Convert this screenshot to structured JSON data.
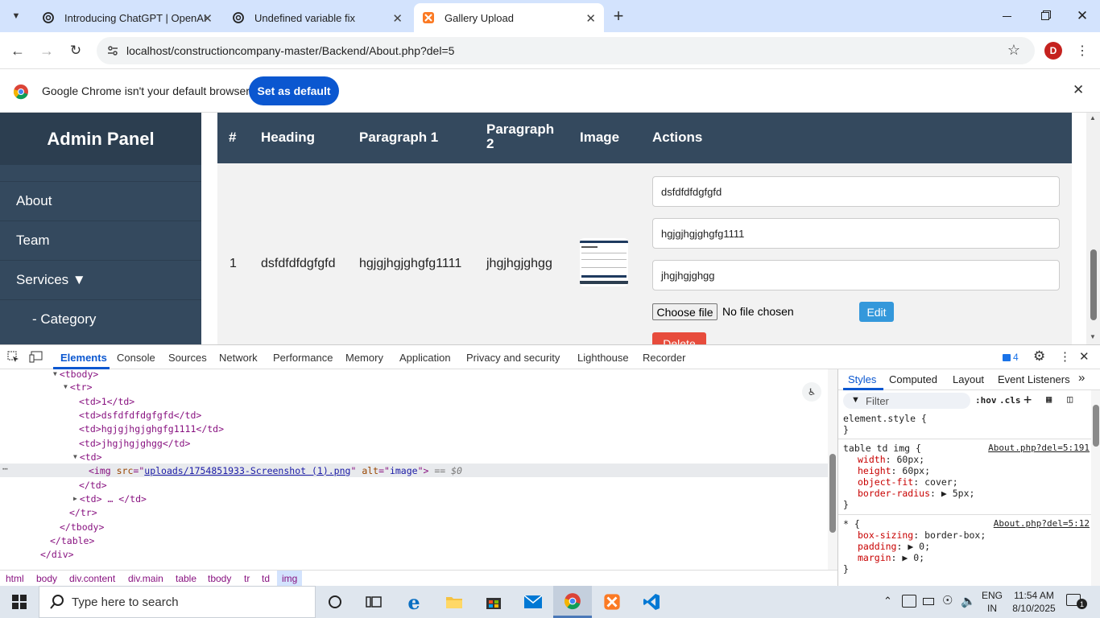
{
  "browser": {
    "tabs": [
      {
        "title": "Introducing ChatGPT | OpenAI",
        "active": false
      },
      {
        "title": "Undefined variable fix",
        "active": false
      },
      {
        "title": "Gallery Upload",
        "active": true
      }
    ],
    "url": "localhost/constructioncompany-master/Backend/About.php?del=5",
    "profile_initial": "D",
    "infobar_text": "Google Chrome isn't your default browser",
    "infobar_button": "Set as default"
  },
  "sidebar": {
    "brand": "Admin Panel",
    "items": [
      {
        "label": "About"
      },
      {
        "label": "Team"
      },
      {
        "label": "Services ▼"
      },
      {
        "label": "- Category"
      }
    ]
  },
  "table": {
    "headers": [
      "#",
      "Heading",
      "Paragraph 1",
      "Paragraph 2",
      "Image",
      "Actions"
    ],
    "row": {
      "id": "1",
      "heading": "dsfdfdfdgfgfd",
      "paragraph1": "hgjgjhgjghgfg1111",
      "paragraph2": "jhgjhgjghgg",
      "image_alt": "image"
    },
    "form": {
      "heading_value": "dsfdfdfdgfgfd",
      "paragraph1_value": "hgjgjhgjghgfg1111",
      "paragraph2_value": "jhgjhgjghgg",
      "choose_file_label": "Choose file",
      "no_file_label": "No file chosen",
      "edit_label": "Edit",
      "delete_label": "Delete"
    }
  },
  "devtools": {
    "tabs": [
      "Elements",
      "Console",
      "Sources",
      "Network",
      "Performance",
      "Memory",
      "Application",
      "Privacy and security",
      "Lighthouse",
      "Recorder"
    ],
    "active_tab": "Elements",
    "issues_count": "4",
    "dom_lines": [
      "<tbody>",
      "<tr>",
      "<td>1</td>",
      "<td>dsfdfdfdgfgfd</td>",
      "<td>hgjgjhgjghgfg1111</td>",
      "<td>jhgjhgjghgg</td>",
      "<td>",
      "</td>",
      "<td> … </td>",
      "</tr>",
      "</tbody>",
      "</table>",
      "</div>"
    ],
    "img_src": "uploads/1754851933-Screenshot (1).png",
    "img_alt": "image",
    "img_suffix": "== $0",
    "breadcrumb": [
      "html",
      "body",
      "div.content",
      "div.main",
      "table",
      "tbody",
      "tr",
      "td",
      "img"
    ],
    "styles_tabs": [
      "Styles",
      "Computed",
      "Layout",
      "Event Listeners"
    ],
    "filter_placeholder": "Filter",
    "hov": ":hov",
    "cls": ".cls",
    "rules": [
      {
        "selector": "element.style {",
        "source": "",
        "props": []
      },
      {
        "selector": "table td img {",
        "source": "About.php?del=5:191",
        "props": [
          [
            "width",
            "60px;"
          ],
          [
            "height",
            "60px;"
          ],
          [
            "object-fit",
            "cover;"
          ],
          [
            "border-radius",
            "▶ 5px;"
          ]
        ]
      },
      {
        "selector": "* {",
        "source": "About.php?del=5:12",
        "props": [
          [
            "box-sizing",
            "border-box;"
          ],
          [
            "padding",
            "▶ 0;"
          ],
          [
            "margin",
            "▶ 0;"
          ]
        ]
      }
    ]
  },
  "taskbar": {
    "search_placeholder": "Type here to search",
    "lang": "ENG",
    "region": "IN",
    "time": "11:54 AM",
    "date": "8/10/2025",
    "notifications": "1"
  }
}
